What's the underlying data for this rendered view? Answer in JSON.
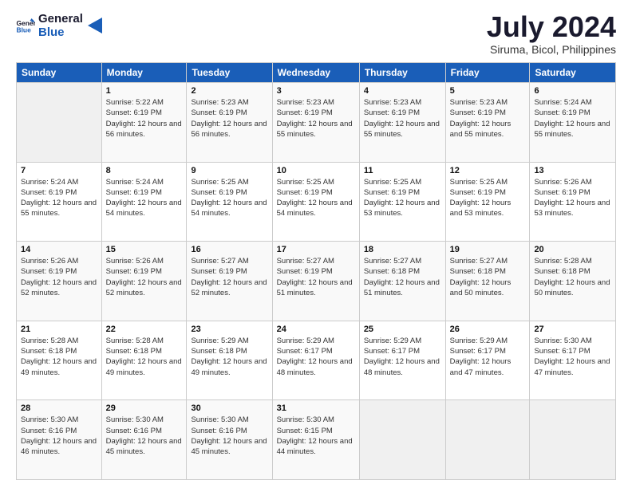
{
  "header": {
    "logo_line1": "General",
    "logo_line2": "Blue",
    "main_title": "July 2024",
    "subtitle": "Siruma, Bicol, Philippines"
  },
  "weekdays": [
    "Sunday",
    "Monday",
    "Tuesday",
    "Wednesday",
    "Thursday",
    "Friday",
    "Saturday"
  ],
  "weeks": [
    [
      {
        "num": "",
        "empty": true
      },
      {
        "num": "1",
        "sunrise": "5:22 AM",
        "sunset": "6:19 PM",
        "daylight": "12 hours and 56 minutes."
      },
      {
        "num": "2",
        "sunrise": "5:23 AM",
        "sunset": "6:19 PM",
        "daylight": "12 hours and 56 minutes."
      },
      {
        "num": "3",
        "sunrise": "5:23 AM",
        "sunset": "6:19 PM",
        "daylight": "12 hours and 55 minutes."
      },
      {
        "num": "4",
        "sunrise": "5:23 AM",
        "sunset": "6:19 PM",
        "daylight": "12 hours and 55 minutes."
      },
      {
        "num": "5",
        "sunrise": "5:23 AM",
        "sunset": "6:19 PM",
        "daylight": "12 hours and 55 minutes."
      },
      {
        "num": "6",
        "sunrise": "5:24 AM",
        "sunset": "6:19 PM",
        "daylight": "12 hours and 55 minutes."
      }
    ],
    [
      {
        "num": "7",
        "sunrise": "5:24 AM",
        "sunset": "6:19 PM",
        "daylight": "12 hours and 55 minutes."
      },
      {
        "num": "8",
        "sunrise": "5:24 AM",
        "sunset": "6:19 PM",
        "daylight": "12 hours and 54 minutes."
      },
      {
        "num": "9",
        "sunrise": "5:25 AM",
        "sunset": "6:19 PM",
        "daylight": "12 hours and 54 minutes."
      },
      {
        "num": "10",
        "sunrise": "5:25 AM",
        "sunset": "6:19 PM",
        "daylight": "12 hours and 54 minutes."
      },
      {
        "num": "11",
        "sunrise": "5:25 AM",
        "sunset": "6:19 PM",
        "daylight": "12 hours and 53 minutes."
      },
      {
        "num": "12",
        "sunrise": "5:25 AM",
        "sunset": "6:19 PM",
        "daylight": "12 hours and 53 minutes."
      },
      {
        "num": "13",
        "sunrise": "5:26 AM",
        "sunset": "6:19 PM",
        "daylight": "12 hours and 53 minutes."
      }
    ],
    [
      {
        "num": "14",
        "sunrise": "5:26 AM",
        "sunset": "6:19 PM",
        "daylight": "12 hours and 52 minutes."
      },
      {
        "num": "15",
        "sunrise": "5:26 AM",
        "sunset": "6:19 PM",
        "daylight": "12 hours and 52 minutes."
      },
      {
        "num": "16",
        "sunrise": "5:27 AM",
        "sunset": "6:19 PM",
        "daylight": "12 hours and 52 minutes."
      },
      {
        "num": "17",
        "sunrise": "5:27 AM",
        "sunset": "6:19 PM",
        "daylight": "12 hours and 51 minutes."
      },
      {
        "num": "18",
        "sunrise": "5:27 AM",
        "sunset": "6:18 PM",
        "daylight": "12 hours and 51 minutes."
      },
      {
        "num": "19",
        "sunrise": "5:27 AM",
        "sunset": "6:18 PM",
        "daylight": "12 hours and 50 minutes."
      },
      {
        "num": "20",
        "sunrise": "5:28 AM",
        "sunset": "6:18 PM",
        "daylight": "12 hours and 50 minutes."
      }
    ],
    [
      {
        "num": "21",
        "sunrise": "5:28 AM",
        "sunset": "6:18 PM",
        "daylight": "12 hours and 49 minutes."
      },
      {
        "num": "22",
        "sunrise": "5:28 AM",
        "sunset": "6:18 PM",
        "daylight": "12 hours and 49 minutes."
      },
      {
        "num": "23",
        "sunrise": "5:29 AM",
        "sunset": "6:18 PM",
        "daylight": "12 hours and 49 minutes."
      },
      {
        "num": "24",
        "sunrise": "5:29 AM",
        "sunset": "6:17 PM",
        "daylight": "12 hours and 48 minutes."
      },
      {
        "num": "25",
        "sunrise": "5:29 AM",
        "sunset": "6:17 PM",
        "daylight": "12 hours and 48 minutes."
      },
      {
        "num": "26",
        "sunrise": "5:29 AM",
        "sunset": "6:17 PM",
        "daylight": "12 hours and 47 minutes."
      },
      {
        "num": "27",
        "sunrise": "5:30 AM",
        "sunset": "6:17 PM",
        "daylight": "12 hours and 47 minutes."
      }
    ],
    [
      {
        "num": "28",
        "sunrise": "5:30 AM",
        "sunset": "6:16 PM",
        "daylight": "12 hours and 46 minutes."
      },
      {
        "num": "29",
        "sunrise": "5:30 AM",
        "sunset": "6:16 PM",
        "daylight": "12 hours and 45 minutes."
      },
      {
        "num": "30",
        "sunrise": "5:30 AM",
        "sunset": "6:16 PM",
        "daylight": "12 hours and 45 minutes."
      },
      {
        "num": "31",
        "sunrise": "5:30 AM",
        "sunset": "6:15 PM",
        "daylight": "12 hours and 44 minutes."
      },
      {
        "num": "",
        "empty": true
      },
      {
        "num": "",
        "empty": true
      },
      {
        "num": "",
        "empty": true
      }
    ]
  ]
}
